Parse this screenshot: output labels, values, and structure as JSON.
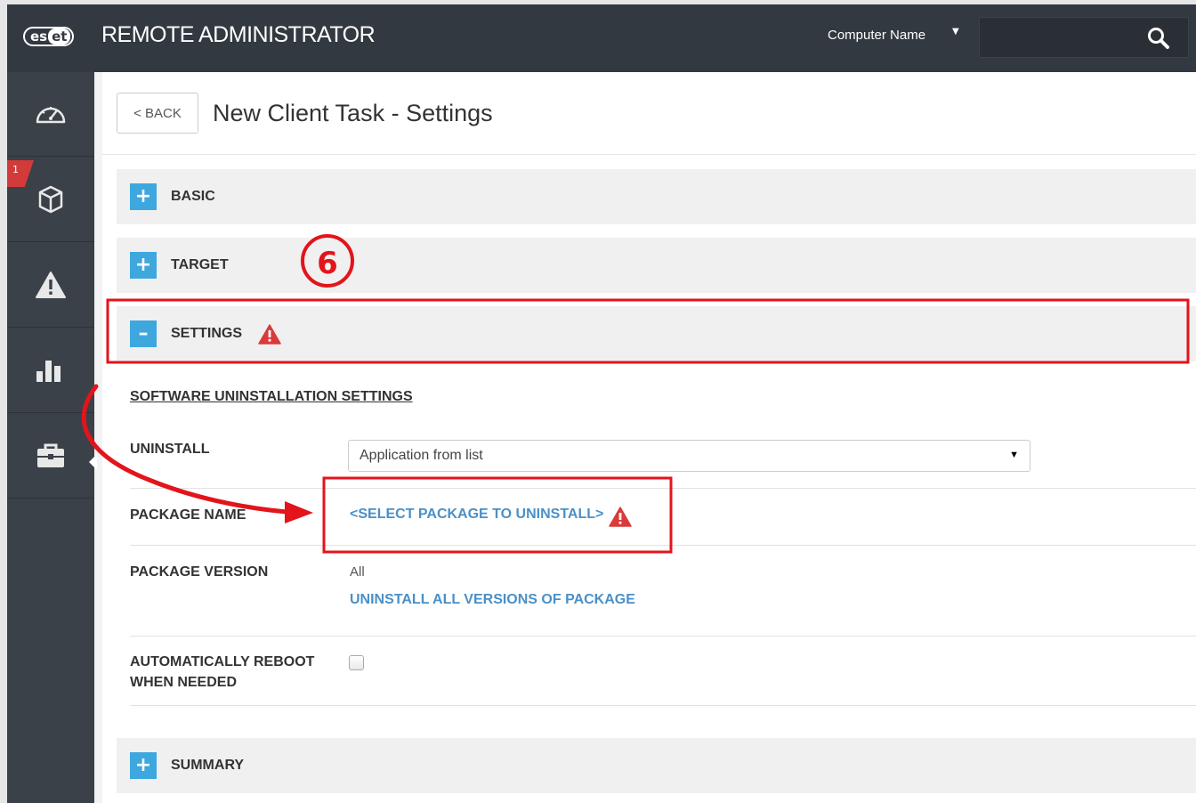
{
  "header": {
    "logo_es": "es",
    "logo_et": "et",
    "app_title": "REMOTE ADMINISTRATOR",
    "search_scope": "Computer Name",
    "search_placeholder": ""
  },
  "sidebar": {
    "items": [
      {
        "icon": "dashboard-icon"
      },
      {
        "icon": "computers-icon",
        "badge": "1"
      },
      {
        "icon": "threats-icon"
      },
      {
        "icon": "reports-icon"
      },
      {
        "icon": "admin-briefcase-icon",
        "active": true
      }
    ]
  },
  "page": {
    "back_label": "< BACK",
    "title": "New Client Task - Settings"
  },
  "sections": {
    "basic": {
      "toggle": "+",
      "label": "BASIC"
    },
    "target": {
      "toggle": "+",
      "label": "TARGET"
    },
    "settings": {
      "toggle": "–",
      "label": "SETTINGS"
    },
    "summary": {
      "toggle": "+",
      "label": "SUMMARY"
    }
  },
  "settings": {
    "subhead": "SOFTWARE UNINSTALLATION SETTINGS",
    "uninstall_label": "UNINSTALL",
    "uninstall_value": "Application from list",
    "package_name_label": "PACKAGE NAME",
    "package_name_link": "<SELECT PACKAGE TO UNINSTALL>",
    "package_version_label": "PACKAGE VERSION",
    "package_version_value": "All",
    "package_version_link": "UNINSTALL ALL VERSIONS OF PACKAGE",
    "reboot_label_line1": "AUTOMATICALLY REBOOT",
    "reboot_label_line2": "WHEN NEEDED",
    "reboot_checked": false
  },
  "annotation": {
    "step_number": "6",
    "highlight_color": "#e3141b"
  },
  "colors": {
    "header_bg": "#323940",
    "sidebar_bg": "#3a4148",
    "accent_blue": "#3ea7de",
    "link_blue": "#4a90c8",
    "warning_red": "#d93a3a"
  }
}
